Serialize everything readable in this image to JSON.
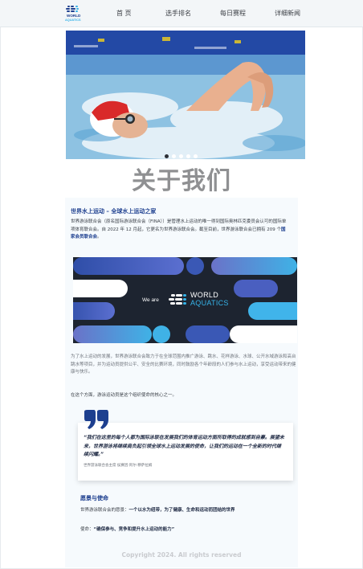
{
  "nav": {
    "logo_text": [
      "WORLD",
      "AQUATICS"
    ],
    "items": [
      "首 页",
      "选手排名",
      "每日赛程",
      "详细新闻"
    ]
  },
  "carousel": {
    "slide_count": 5,
    "active_index": 0
  },
  "page_title": "关于我们",
  "about": {
    "title": "世界水上运动 – 全球水上运动之家",
    "intro_before_link": "世界游泳联合会（原名国际游泳联合会（FINA））是管理水上运动的唯一得到国际奥林匹克委员会认可的国际单项体育联合会。自 2022 年 12 月起，它更名为世界游泳联合会。截至目前，世界游泳联合会已拥有 209 个",
    "intro_link": "国家会员联合会",
    "intro_after_link": "。"
  },
  "banner": {
    "we_are": "We are",
    "world": "WORLD",
    "aquatics": "AQUATICS"
  },
  "paragraphs": {
    "p2": "为了水上运动的发展，世界游泳联合会致力于在全球范围内推广游泳、跳水、花样游泳、水球、公开水域游泳和高台跳水等项目，并为运动员提供公平、安全的比赛环境，同时鼓励各个年龄段的人们参与水上运动，享受运动带来的健康与快乐。",
    "p3": "在这个方面，游泳运动员是这个组织使命的核心之一。"
  },
  "quote": {
    "text": "“我们在这里的每个人都为国际泳联在发展我们的体育运动方面所取得的成就感到自豪。展望未来，世界游泳将继续肩负起引领全球水上运动发展的使命，让我们的运动在一个全新的时代继续闪耀。”",
    "author": "世界游泳联合会主席 侯赛因·阿尔·穆萨拉姆"
  },
  "vision": {
    "title": "愿景与使命",
    "vision_label": "世界游泳联合会的愿景：",
    "vision_text": "一个以水为纽带，为了健康、生命和运动而团结的世界",
    "mission_label": "使命：",
    "mission_text": "“确保参与、竞争和提升水上运动的能力”"
  },
  "footer": "Copyright 2024. All rights reserved",
  "colors": {
    "brand_blue": "#1d3f8f",
    "aquatics_cyan": "#36b3e8",
    "banner_dark": "#1d2430",
    "title_gray": "#8f9092"
  }
}
